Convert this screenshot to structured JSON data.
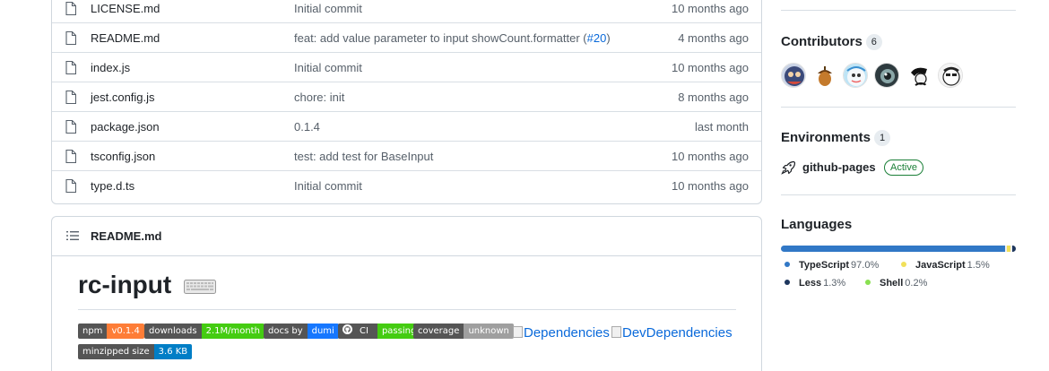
{
  "files": [
    {
      "name": "LICENSE.md",
      "message": "Initial commit",
      "date": "10 months ago"
    },
    {
      "name": "README.md",
      "message": "feat: add value parameter to input showCount.formatter (",
      "link": "#20",
      "message_suffix": ")",
      "date": "4 months ago"
    },
    {
      "name": "index.js",
      "message": "Initial commit",
      "date": "10 months ago"
    },
    {
      "name": "jest.config.js",
      "message": "chore: init",
      "date": "8 months ago"
    },
    {
      "name": "package.json",
      "message": "0.1.4",
      "date": "last month"
    },
    {
      "name": "tsconfig.json",
      "message": "test: add test for BaseInput",
      "date": "10 months ago"
    },
    {
      "name": "type.d.ts",
      "message": "Initial commit",
      "date": "10 months ago"
    }
  ],
  "readme": {
    "header_title": "README.md",
    "title": "rc-input",
    "badges": {
      "npm": {
        "label": "npm",
        "value": "v0.1.4"
      },
      "downloads": {
        "label": "downloads",
        "value": "2.1M/month"
      },
      "docs": {
        "label": "docs by",
        "value": "dumi"
      },
      "ci": {
        "label": "CI",
        "value": "passing"
      },
      "coverage": {
        "label": "coverage",
        "value": "unknown"
      },
      "dependencies": "Dependencies",
      "dev_dependencies": "DevDependencies",
      "size": {
        "label": "minzipped size",
        "value": "3.6 KB"
      }
    }
  },
  "sidebar": {
    "contributors": {
      "title": "Contributors",
      "count": "6"
    },
    "environments": {
      "title": "Environments",
      "count": "1",
      "name": "github-pages",
      "status": "Active"
    },
    "languages": {
      "title": "Languages",
      "items": [
        {
          "name": "TypeScript",
          "percent": "97.0%",
          "value": 97.0,
          "color": "#3178c6"
        },
        {
          "name": "JavaScript",
          "percent": "1.5%",
          "value": 1.5,
          "color": "#f1e05a"
        },
        {
          "name": "Less",
          "percent": "1.3%",
          "value": 1.3,
          "color": "#1d365d"
        },
        {
          "name": "Shell",
          "percent": "0.2%",
          "value": 0.2,
          "color": "#89e051"
        }
      ]
    }
  }
}
